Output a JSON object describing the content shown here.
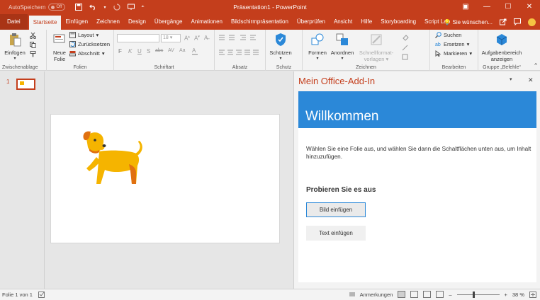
{
  "titlebar": {
    "autosave_label": "AutoSpeichern",
    "autosave_state": "Off",
    "title": "Präsentation1 - PowerPoint",
    "window_controls": [
      "minimize-icon",
      "restore-icon",
      "close-icon"
    ]
  },
  "tabs": {
    "file": "Datei",
    "items": [
      "Startseite",
      "Einfügen",
      "Zeichnen",
      "Design",
      "Übergänge",
      "Animationen",
      "Bildschirmpräsentation",
      "Überprüfen",
      "Ansicht",
      "Hilfe",
      "Storyboarding",
      "Script Lab"
    ],
    "active": "Startseite",
    "tell_me": "Sie wünschen..."
  },
  "ribbon": {
    "clipboard": {
      "label": "Zwischenablage",
      "paste": "Einfügen"
    },
    "slides": {
      "label": "Folien",
      "new_slide_1": "Neue",
      "new_slide_2": "Folie",
      "layout": "Layout",
      "reset": "Zurücksetzen",
      "section": "Abschnitt"
    },
    "font": {
      "label": "Schriftart",
      "size": "18"
    },
    "paragraph": {
      "label": "Absatz"
    },
    "protect": {
      "label": "Schutz",
      "btn": "Schützen"
    },
    "drawing": {
      "label": "Zeichnen",
      "shapes": "Formen",
      "arrange": "Anordnen",
      "quick_styles_1": "Schnellformat-",
      "quick_styles_2": "vorlagen"
    },
    "editing": {
      "label": "Bearbeiten",
      "find": "Suchen",
      "replace": "Ersetzen",
      "select": "Markieren"
    },
    "commands": {
      "label": "Gruppe „Befehle“",
      "btn_1": "Aufgabenbereich",
      "btn_2": "anzeigen"
    }
  },
  "thumbnails": {
    "number": "1"
  },
  "taskpane": {
    "title": "Mein Office-Add-In",
    "banner": "Willkommen",
    "description": "Wählen Sie eine Folie aus, und wählen Sie dann die Schaltflächen unten aus, um Inhalt hinzuzufügen.",
    "try_heading": "Probieren Sie es aus",
    "btn_image": "Bild einfügen",
    "btn_text": "Text einfügen"
  },
  "statusbar": {
    "slide_info": "Folie 1 von 1",
    "notes": "Anmerkungen",
    "zoom": "38 %"
  },
  "colors": {
    "accent": "#c43e1c",
    "banner": "#2b88d8",
    "dog_body": "#f5b400",
    "dog_dark": "#e07010"
  }
}
